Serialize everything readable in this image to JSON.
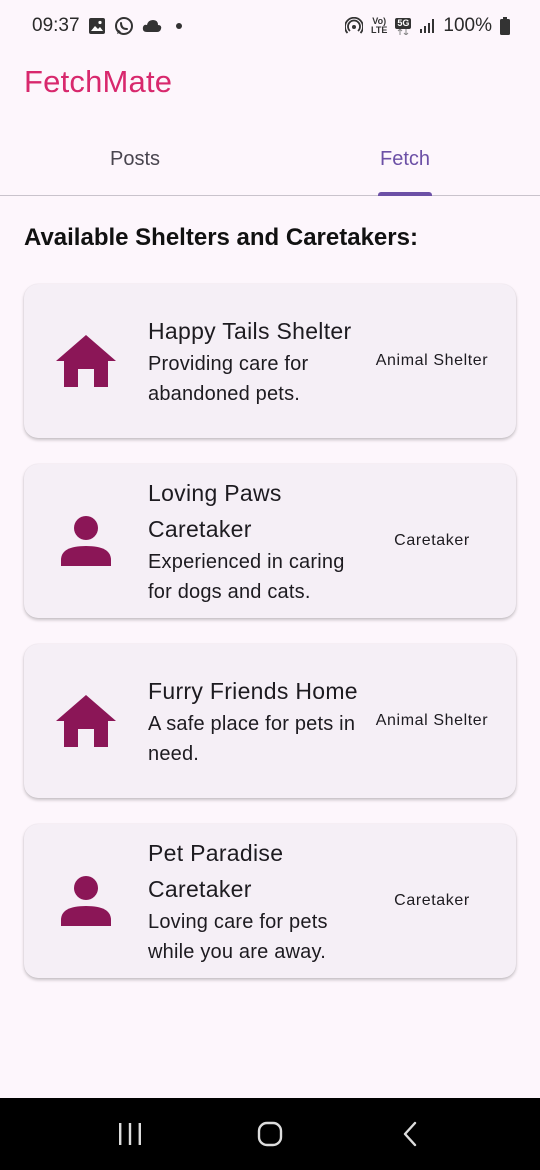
{
  "status_bar": {
    "time": "09:37",
    "battery": "100%",
    "volte_label": "Vo)\nLTE",
    "network_label": "5G",
    "icons": [
      "image-icon",
      "whatsapp-icon",
      "cloud-icon",
      "hotspot-icon",
      "volte-icon",
      "5g-icon",
      "signal-icon",
      "battery-icon"
    ]
  },
  "app": {
    "title": "FetchMate",
    "title_color": "#d8286d",
    "accent_color": "#6c50a6",
    "icon_color": "#8b1657"
  },
  "tabs": [
    {
      "label": "Posts",
      "active": false
    },
    {
      "label": "Fetch",
      "active": true
    }
  ],
  "main": {
    "heading": "Available Shelters and Caretakers:",
    "items": [
      {
        "icon": "house-icon",
        "title": "Happy Tails Shelter",
        "description": "Providing care for abandoned pets.",
        "type": "Animal Shelter"
      },
      {
        "icon": "person-icon",
        "title": "Loving Paws Caretaker",
        "description": "Experienced in caring for dogs and cats.",
        "type": "Caretaker"
      },
      {
        "icon": "house-icon",
        "title": "Furry Friends Home",
        "description": "A safe place for pets in need.",
        "type": "Animal Shelter"
      },
      {
        "icon": "person-icon",
        "title": "Pet Paradise Caretaker",
        "description": "Loving care for pets while you are away.",
        "type": "Caretaker"
      }
    ]
  },
  "nav_bar": {
    "buttons": [
      "recent-apps-icon",
      "home-icon",
      "back-icon"
    ]
  }
}
